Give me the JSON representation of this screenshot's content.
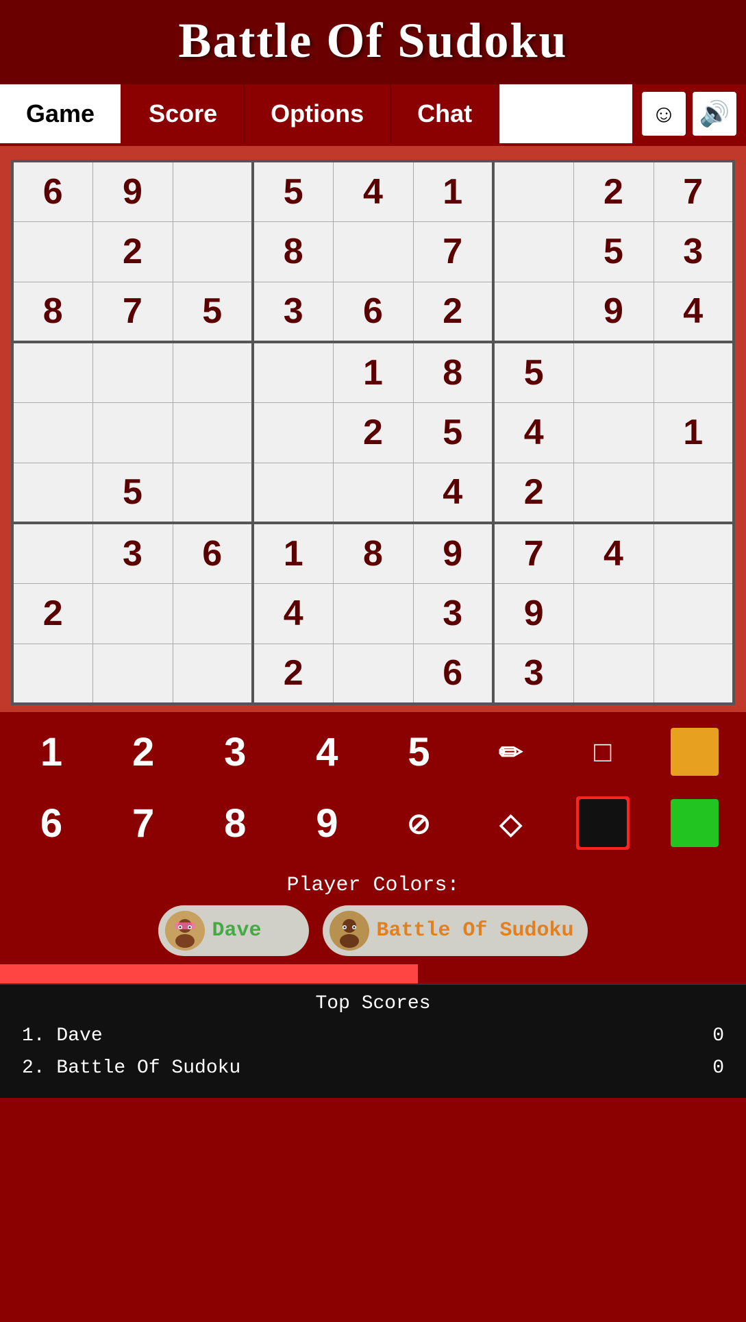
{
  "app": {
    "title": "Battle Of Sudoku"
  },
  "nav": {
    "tabs": [
      {
        "label": "Game",
        "active": true
      },
      {
        "label": "Score",
        "active": false
      },
      {
        "label": "Options",
        "active": false
      },
      {
        "label": "Chat",
        "active": false
      }
    ],
    "emoji_icon": "☺",
    "sound_icon": "🔊"
  },
  "sudoku": {
    "grid": [
      [
        "6",
        "9",
        "",
        "5",
        "4",
        "1",
        "",
        "2",
        "7"
      ],
      [
        "",
        "2",
        "",
        "8",
        "",
        "7",
        "",
        "5",
        "3"
      ],
      [
        "8",
        "7",
        "5",
        "3",
        "6",
        "2",
        "",
        "9",
        "4"
      ],
      [
        "",
        "",
        "",
        "",
        "1",
        "8",
        "5",
        "",
        ""
      ],
      [
        "",
        "",
        "",
        "",
        "2",
        "5",
        "4",
        "",
        "1"
      ],
      [
        "",
        "5",
        "",
        "",
        "",
        "4",
        "2",
        "",
        ""
      ],
      [
        "",
        "3",
        "6",
        "1",
        "8",
        "9",
        "7",
        "4",
        ""
      ],
      [
        "2",
        "",
        "",
        "4",
        "",
        "3",
        "9",
        "",
        ""
      ],
      [
        "",
        "",
        "",
        "2",
        "",
        "6",
        "3",
        "",
        ""
      ]
    ]
  },
  "number_pad": {
    "row1": [
      "1",
      "2",
      "3",
      "4",
      "5"
    ],
    "row1_icons": [
      "pencil",
      "square"
    ],
    "row1_color": "orange",
    "row2": [
      "6",
      "7",
      "8",
      "9"
    ],
    "row2_icons": [
      "no",
      "fill"
    ],
    "row2_colors": [
      "black",
      "green"
    ],
    "pencil_icon": "✏",
    "square_icon": "□",
    "no_icon": "⊘",
    "fill_icon": "◇"
  },
  "player_colors": {
    "label": "Player Colors:",
    "players": [
      {
        "name": "Dave",
        "color_class": "player-name-dave",
        "avatar": "😎"
      },
      {
        "name": "Battle Of Sudoku",
        "color_class": "player-name-bot",
        "avatar": "🤓"
      }
    ]
  },
  "top_scores": {
    "header": "Top Scores",
    "scores": [
      {
        "rank": "1.",
        "name": "Dave",
        "score": "0"
      },
      {
        "rank": "2.",
        "name": "Battle Of Sudoku",
        "score": "0"
      }
    ]
  }
}
